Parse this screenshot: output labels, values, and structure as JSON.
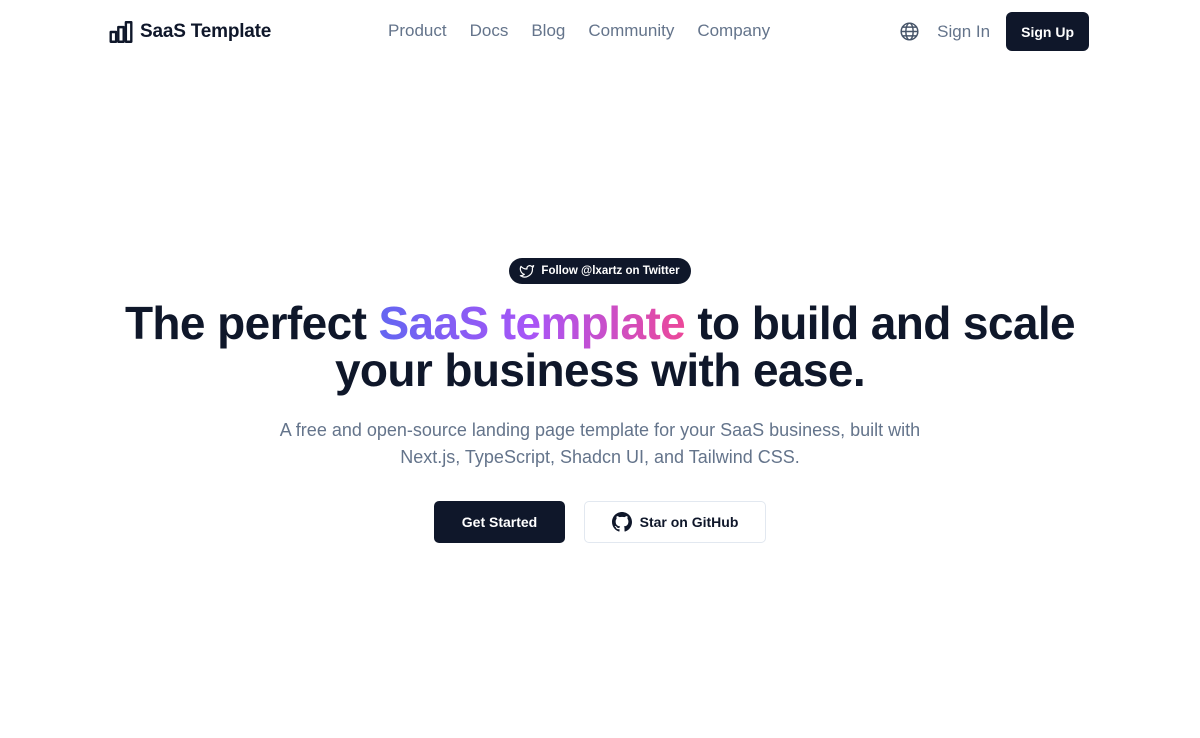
{
  "header": {
    "brand_name": "SaaS Template",
    "brand_icon": "bar-chart-icon",
    "nav": [
      {
        "label": "Product"
      },
      {
        "label": "Docs"
      },
      {
        "label": "Blog"
      },
      {
        "label": "Community"
      },
      {
        "label": "Company"
      }
    ],
    "language_icon": "globe-icon",
    "sign_in_label": "Sign In",
    "sign_up_label": "Sign Up"
  },
  "hero": {
    "badge_label": "Follow @lxartz on Twitter",
    "badge_icon": "twitter-icon",
    "headline_before": "The perfect ",
    "headline_highlight": "SaaS template",
    "headline_after": " to build and scale your business with ease.",
    "subtitle": "A free and open-source landing page template for your SaaS business, built with Next.js, TypeScript, Shadcn UI, and Tailwind CSS.",
    "primary_cta": "Get Started",
    "secondary_cta": "Star on GitHub",
    "secondary_cta_icon": "github-icon"
  },
  "colors": {
    "primary": "#0f172a",
    "muted_text": "#64748b",
    "border": "#e2e8f0",
    "gradient_start": "#6366f1",
    "gradient_mid": "#a855f7",
    "gradient_end": "#ec4899"
  }
}
